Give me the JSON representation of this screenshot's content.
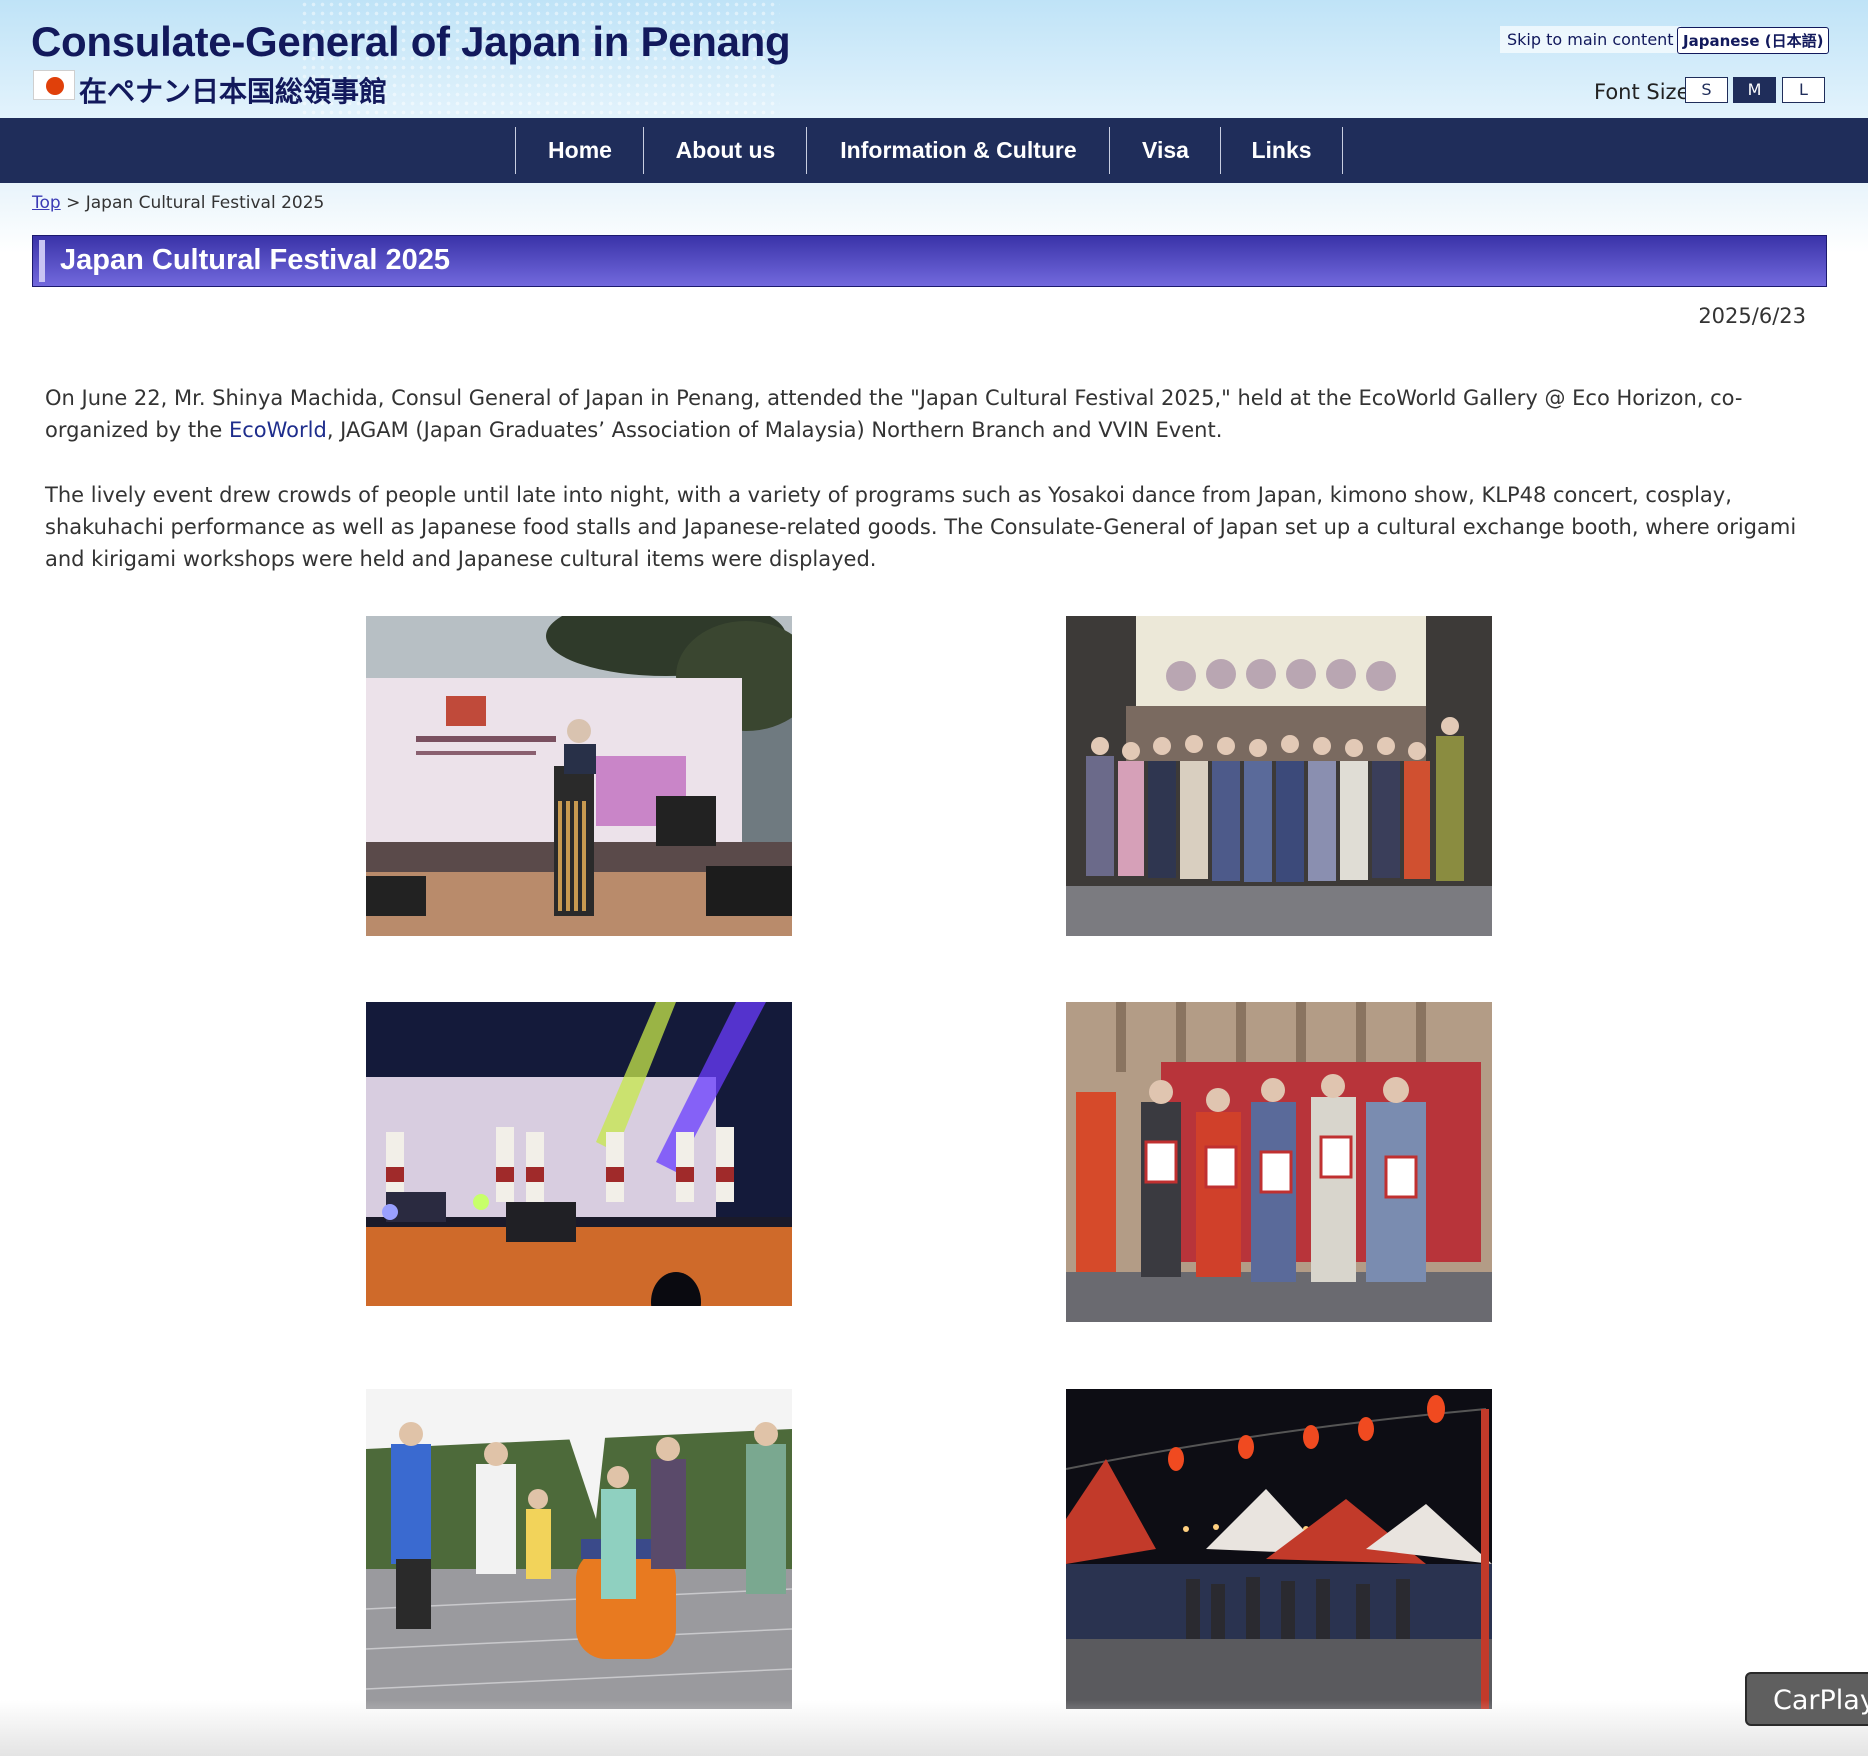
{
  "header": {
    "title": "Consulate-General of Japan in Penang",
    "subtitle": "在ペナン日本国総領事館",
    "skip_link": "Skip to main content",
    "language_button": "Japanese (日本語)",
    "font_size_label": "Font Size",
    "font_sizes": [
      "S",
      "M",
      "L"
    ],
    "font_size_selected": "M"
  },
  "nav": {
    "items": [
      "Home",
      "About us",
      "Information & Culture",
      "Visa",
      "Links"
    ]
  },
  "breadcrumb": {
    "top_link": "Top",
    "separator": ">",
    "current": "Japan Cultural Festival 2025"
  },
  "article": {
    "heading": "Japan Cultural Festival 2025",
    "date": "2025/6/23",
    "para1_before_link": "On June 22, Mr. Shinya Machida, Consul General of Japan in Penang, attended the \"Japan Cultural Festival 2025,\" held at the EcoWorld Gallery @ Eco Horizon, co-organized by the ",
    "para1_link": "EcoWorld",
    "para1_after_link": ", JAGAM (Japan Graduates’ Association of Malaysia) Northern Branch and VVIN Event.",
    "para2": "The lively event drew crowds of people until late into night, with a variety of programs such as Yosakoi dance from Japan, kimono show, KLP48 concert, cosplay, shakuhachi performance as well as Japanese food stalls and Japanese-related goods. The Consulate-General of Japan set up a cultural exchange booth, where origami and kirigami workshops were held and Japanese cultural items were displayed."
  },
  "overlay": {
    "carplay_label": "CarPlay"
  },
  "colors": {
    "nav_bg": "#1f2d5a",
    "title_text": "#12195c",
    "heading_gradient_top": "#3a33a8",
    "heading_gradient_bottom": "#7269dd",
    "link": "#1e2d8c"
  }
}
